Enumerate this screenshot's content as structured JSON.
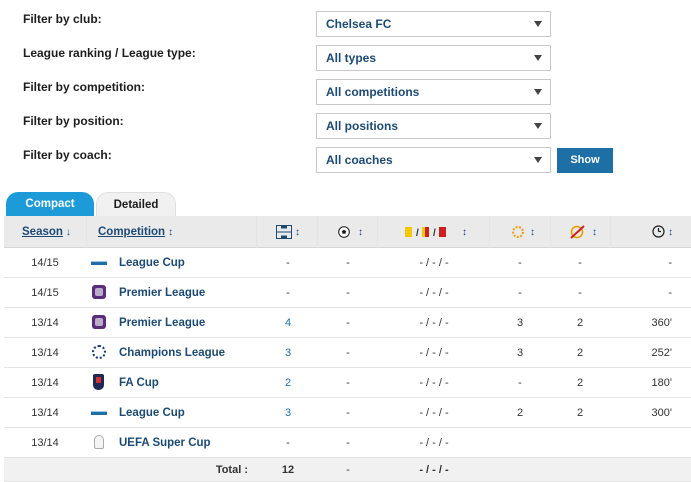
{
  "filters": [
    {
      "label": "Filter by club:",
      "value": "Chelsea FC"
    },
    {
      "label": "League ranking / League type:",
      "value": "All types"
    },
    {
      "label": "Filter by competition:",
      "value": "All competitions"
    },
    {
      "label": "Filter by position:",
      "value": "All positions"
    },
    {
      "label": "Filter by coach:",
      "value": "All coaches"
    }
  ],
  "show_button": "Show",
  "tabs": {
    "compact": "Compact",
    "detailed": "Detailed",
    "active": "compact"
  },
  "columns": {
    "season": "Season",
    "competition": "Competition",
    "apps_icon": "lineup-icon",
    "goals_icon": "ball-icon",
    "cards_icon": "cards-icon",
    "cards_sep": "/ /",
    "sub_on_icon": "substituted-on-icon",
    "sub_off_icon": "substituted-off-icon",
    "minutes_icon": "clock-icon"
  },
  "rows": [
    {
      "season": "14/15",
      "logo": "league-cup-logo",
      "competition": "League Cup",
      "apps": "-",
      "goals": "-",
      "cards": "- / - / -",
      "sub_on": "-",
      "sub_off": "-",
      "minutes": "-"
    },
    {
      "season": "14/15",
      "logo": "premier-league-logo",
      "competition": "Premier League",
      "apps": "-",
      "goals": "-",
      "cards": "- / - / -",
      "sub_on": "-",
      "sub_off": "-",
      "minutes": "-"
    },
    {
      "season": "13/14",
      "logo": "premier-league-logo",
      "competition": "Premier League",
      "apps": "4",
      "goals": "-",
      "cards": "- / - / -",
      "sub_on": "3",
      "sub_off": "2",
      "minutes": "360'"
    },
    {
      "season": "13/14",
      "logo": "champions-league-logo",
      "competition": "Champions League",
      "apps": "3",
      "goals": "-",
      "cards": "- / - / -",
      "sub_on": "3",
      "sub_off": "2",
      "minutes": "252'"
    },
    {
      "season": "13/14",
      "logo": "fa-cup-logo",
      "competition": "FA Cup",
      "apps": "2",
      "goals": "-",
      "cards": "- / - / -",
      "sub_on": "-",
      "sub_off": "2",
      "minutes": "180'"
    },
    {
      "season": "13/14",
      "logo": "league-cup-logo",
      "competition": "League Cup",
      "apps": "3",
      "goals": "-",
      "cards": "- / - / -",
      "sub_on": "2",
      "sub_off": "2",
      "minutes": "300'"
    },
    {
      "season": "13/14",
      "logo": "uefa-super-cup-logo",
      "competition": "UEFA Super Cup",
      "apps": "-",
      "goals": "-",
      "cards": "- / - / -",
      "sub_on": "",
      "sub_off": "",
      "minutes": ""
    }
  ],
  "total": {
    "label": "Total :",
    "apps": "12",
    "goals": "-",
    "cards": "- / - / -"
  }
}
